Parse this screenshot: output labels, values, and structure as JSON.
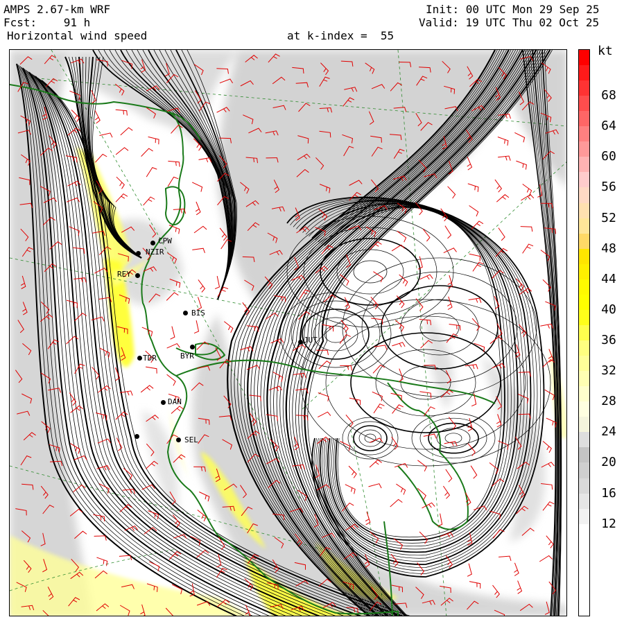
{
  "header": {
    "model": "AMPS 2.67-km WRF",
    "init": "Init: 00 UTC Mon 29 Sep 25",
    "forecast": "Fcst:    91 h",
    "valid": "Valid: 19 UTC Thu 02 Oct 25",
    "field": "Horizontal wind speed",
    "level": "at k-index =  55"
  },
  "colorbar": {
    "unit": "kt",
    "ticks": [
      "68",
      "64",
      "60",
      "56",
      "52",
      "48",
      "44",
      "40",
      "36",
      "32",
      "28",
      "24",
      "20",
      "16",
      "12"
    ],
    "bins": [
      {
        "min": 0,
        "max": 12,
        "color": "#ffffff"
      },
      {
        "min": 12,
        "max": 14,
        "color": "#f2f2f2"
      },
      {
        "min": 14,
        "max": 16,
        "color": "#e6e6e6"
      },
      {
        "min": 16,
        "max": 18,
        "color": "#d9d9d9"
      },
      {
        "min": 18,
        "max": 20,
        "color": "#cfcfcf"
      },
      {
        "min": 20,
        "max": 22,
        "color": "#c4c4c4"
      },
      {
        "min": 22,
        "max": 24,
        "color": "#dedede"
      },
      {
        "min": 24,
        "max": 26,
        "color": "#f5f5dc"
      },
      {
        "min": 26,
        "max": 28,
        "color": "#ffffe0"
      },
      {
        "min": 28,
        "max": 30,
        "color": "#ffffcc"
      },
      {
        "min": 30,
        "max": 32,
        "color": "#ffffb3"
      },
      {
        "min": 32,
        "max": 34,
        "color": "#ffff99"
      },
      {
        "min": 34,
        "max": 36,
        "color": "#ffff80"
      },
      {
        "min": 36,
        "max": 38,
        "color": "#ffff4d"
      },
      {
        "min": 38,
        "max": 40,
        "color": "#ffff1a"
      },
      {
        "min": 40,
        "max": 42,
        "color": "#ffff00"
      },
      {
        "min": 42,
        "max": 44,
        "color": "#fffa00"
      },
      {
        "min": 44,
        "max": 46,
        "color": "#fff000"
      },
      {
        "min": 46,
        "max": 48,
        "color": "#ffe600"
      },
      {
        "min": 48,
        "max": 50,
        "color": "#ffd966"
      },
      {
        "min": 50,
        "max": 52,
        "color": "#ffe699"
      },
      {
        "min": 52,
        "max": 54,
        "color": "#ffe0b0"
      },
      {
        "min": 54,
        "max": 56,
        "color": "#ffd9c4"
      },
      {
        "min": 56,
        "max": 58,
        "color": "#ffcccc"
      },
      {
        "min": 58,
        "max": 60,
        "color": "#ffb3b3"
      },
      {
        "min": 60,
        "max": 62,
        "color": "#ff9999"
      },
      {
        "min": 62,
        "max": 64,
        "color": "#ff8080"
      },
      {
        "min": 64,
        "max": 66,
        "color": "#ff6666"
      },
      {
        "min": 66,
        "max": 68,
        "color": "#ff4d4d"
      },
      {
        "min": 68,
        "max": 70,
        "color": "#ff3333"
      },
      {
        "min": 70,
        "max": 72,
        "color": "#ff1a1a"
      },
      {
        "min": 72,
        "max": 74,
        "color": "#ff0000"
      }
    ]
  },
  "stations": [
    "CPW",
    "NZIR",
    "REY",
    "BIS",
    "TDR",
    "DAN",
    "SEL",
    "BYR",
    "JUT"
  ],
  "colors": {
    "coastline": "#1a7a1a",
    "contour": "#000000",
    "wind_barb": "#e00000",
    "gridline": "#2e8b2e",
    "shade_gray": "#c8c8c8",
    "shade_yellow": "#ffff55"
  }
}
